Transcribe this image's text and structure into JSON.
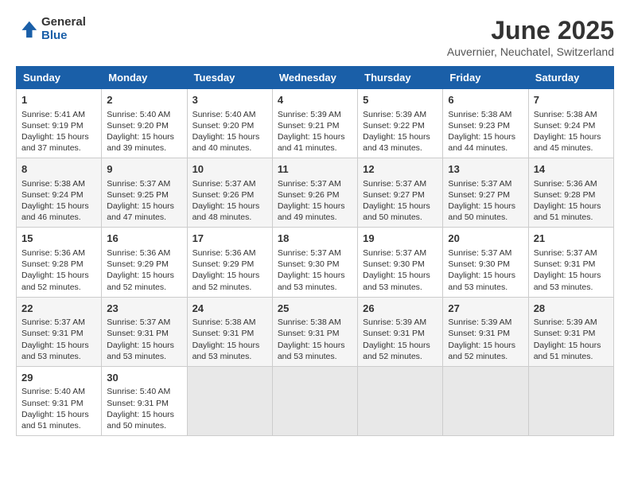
{
  "app": {
    "name_general": "General",
    "name_blue": "Blue"
  },
  "calendar": {
    "title": "June 2025",
    "subtitle": "Auvernier, Neuchatel, Switzerland",
    "days_of_week": [
      "Sunday",
      "Monday",
      "Tuesday",
      "Wednesday",
      "Thursday",
      "Friday",
      "Saturday"
    ],
    "weeks": [
      [
        null,
        {
          "day": "2",
          "sunrise": "Sunrise: 5:40 AM",
          "sunset": "Sunset: 9:20 PM",
          "daylight": "Daylight: 15 hours and 39 minutes."
        },
        {
          "day": "3",
          "sunrise": "Sunrise: 5:40 AM",
          "sunset": "Sunset: 9:20 PM",
          "daylight": "Daylight: 15 hours and 40 minutes."
        },
        {
          "day": "4",
          "sunrise": "Sunrise: 5:39 AM",
          "sunset": "Sunset: 9:21 PM",
          "daylight": "Daylight: 15 hours and 41 minutes."
        },
        {
          "day": "5",
          "sunrise": "Sunrise: 5:39 AM",
          "sunset": "Sunset: 9:22 PM",
          "daylight": "Daylight: 15 hours and 43 minutes."
        },
        {
          "day": "6",
          "sunrise": "Sunrise: 5:38 AM",
          "sunset": "Sunset: 9:23 PM",
          "daylight": "Daylight: 15 hours and 44 minutes."
        },
        {
          "day": "7",
          "sunrise": "Sunrise: 5:38 AM",
          "sunset": "Sunset: 9:24 PM",
          "daylight": "Daylight: 15 hours and 45 minutes."
        }
      ],
      [
        {
          "day": "1",
          "sunrise": "Sunrise: 5:41 AM",
          "sunset": "Sunset: 9:19 PM",
          "daylight": "Daylight: 15 hours and 37 minutes."
        },
        null,
        null,
        null,
        null,
        null,
        null
      ],
      [
        {
          "day": "8",
          "sunrise": "Sunrise: 5:38 AM",
          "sunset": "Sunset: 9:24 PM",
          "daylight": "Daylight: 15 hours and 46 minutes."
        },
        {
          "day": "9",
          "sunrise": "Sunrise: 5:37 AM",
          "sunset": "Sunset: 9:25 PM",
          "daylight": "Daylight: 15 hours and 47 minutes."
        },
        {
          "day": "10",
          "sunrise": "Sunrise: 5:37 AM",
          "sunset": "Sunset: 9:26 PM",
          "daylight": "Daylight: 15 hours and 48 minutes."
        },
        {
          "day": "11",
          "sunrise": "Sunrise: 5:37 AM",
          "sunset": "Sunset: 9:26 PM",
          "daylight": "Daylight: 15 hours and 49 minutes."
        },
        {
          "day": "12",
          "sunrise": "Sunrise: 5:37 AM",
          "sunset": "Sunset: 9:27 PM",
          "daylight": "Daylight: 15 hours and 50 minutes."
        },
        {
          "day": "13",
          "sunrise": "Sunrise: 5:37 AM",
          "sunset": "Sunset: 9:27 PM",
          "daylight": "Daylight: 15 hours and 50 minutes."
        },
        {
          "day": "14",
          "sunrise": "Sunrise: 5:36 AM",
          "sunset": "Sunset: 9:28 PM",
          "daylight": "Daylight: 15 hours and 51 minutes."
        }
      ],
      [
        {
          "day": "15",
          "sunrise": "Sunrise: 5:36 AM",
          "sunset": "Sunset: 9:28 PM",
          "daylight": "Daylight: 15 hours and 52 minutes."
        },
        {
          "day": "16",
          "sunrise": "Sunrise: 5:36 AM",
          "sunset": "Sunset: 9:29 PM",
          "daylight": "Daylight: 15 hours and 52 minutes."
        },
        {
          "day": "17",
          "sunrise": "Sunrise: 5:36 AM",
          "sunset": "Sunset: 9:29 PM",
          "daylight": "Daylight: 15 hours and 52 minutes."
        },
        {
          "day": "18",
          "sunrise": "Sunrise: 5:37 AM",
          "sunset": "Sunset: 9:30 PM",
          "daylight": "Daylight: 15 hours and 53 minutes."
        },
        {
          "day": "19",
          "sunrise": "Sunrise: 5:37 AM",
          "sunset": "Sunset: 9:30 PM",
          "daylight": "Daylight: 15 hours and 53 minutes."
        },
        {
          "day": "20",
          "sunrise": "Sunrise: 5:37 AM",
          "sunset": "Sunset: 9:30 PM",
          "daylight": "Daylight: 15 hours and 53 minutes."
        },
        {
          "day": "21",
          "sunrise": "Sunrise: 5:37 AM",
          "sunset": "Sunset: 9:31 PM",
          "daylight": "Daylight: 15 hours and 53 minutes."
        }
      ],
      [
        {
          "day": "22",
          "sunrise": "Sunrise: 5:37 AM",
          "sunset": "Sunset: 9:31 PM",
          "daylight": "Daylight: 15 hours and 53 minutes."
        },
        {
          "day": "23",
          "sunrise": "Sunrise: 5:37 AM",
          "sunset": "Sunset: 9:31 PM",
          "daylight": "Daylight: 15 hours and 53 minutes."
        },
        {
          "day": "24",
          "sunrise": "Sunrise: 5:38 AM",
          "sunset": "Sunset: 9:31 PM",
          "daylight": "Daylight: 15 hours and 53 minutes."
        },
        {
          "day": "25",
          "sunrise": "Sunrise: 5:38 AM",
          "sunset": "Sunset: 9:31 PM",
          "daylight": "Daylight: 15 hours and 53 minutes."
        },
        {
          "day": "26",
          "sunrise": "Sunrise: 5:39 AM",
          "sunset": "Sunset: 9:31 PM",
          "daylight": "Daylight: 15 hours and 52 minutes."
        },
        {
          "day": "27",
          "sunrise": "Sunrise: 5:39 AM",
          "sunset": "Sunset: 9:31 PM",
          "daylight": "Daylight: 15 hours and 52 minutes."
        },
        {
          "day": "28",
          "sunrise": "Sunrise: 5:39 AM",
          "sunset": "Sunset: 9:31 PM",
          "daylight": "Daylight: 15 hours and 51 minutes."
        }
      ],
      [
        {
          "day": "29",
          "sunrise": "Sunrise: 5:40 AM",
          "sunset": "Sunset: 9:31 PM",
          "daylight": "Daylight: 15 hours and 51 minutes."
        },
        {
          "day": "30",
          "sunrise": "Sunrise: 5:40 AM",
          "sunset": "Sunset: 9:31 PM",
          "daylight": "Daylight: 15 hours and 50 minutes."
        },
        null,
        null,
        null,
        null,
        null
      ]
    ]
  }
}
